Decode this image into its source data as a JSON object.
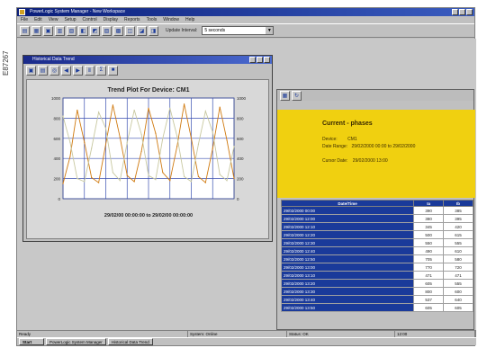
{
  "side_label": "E87267",
  "app": {
    "title": "PowerLogic System Manager - New Workspace",
    "menu": [
      "File",
      "Edit",
      "View",
      "Setup",
      "Control",
      "Display",
      "Reports",
      "Tools",
      "Window",
      "Help"
    ],
    "toolbar_label": "Update Interval:",
    "toolbar_combo": "5 seconds"
  },
  "chart_window": {
    "title": "Historical Data Trend",
    "chart_title": "Trend Plot For Device: CM1",
    "date_range": "29/02/00 00:00:00  to  29/02/00 00:00:00"
  },
  "event_window": {
    "panel_title": "Current - phases",
    "device_label": "Device:",
    "device_value": "CM1",
    "range_label": "Date Range:",
    "range_value": "29/02/2000 00:00 to 29/02/2000",
    "cursor_label": "Cursor Date:",
    "cursor_value": "29/02/2000 13:00",
    "columns": [
      "Date/Time",
      "Ia",
      "Ib"
    ],
    "rows": [
      [
        "29/02/2000 00:00",
        "390",
        "385"
      ],
      [
        "29/02/2000 12:00",
        "380",
        "395"
      ],
      [
        "29/02/2000 12:10",
        "345",
        "420"
      ],
      [
        "29/02/2000 12:20",
        "500",
        "615"
      ],
      [
        "29/02/2000 12:30",
        "550",
        "555"
      ],
      [
        "29/02/2000 12:40",
        "490",
        "610"
      ],
      [
        "29/02/2000 12:50",
        "705",
        "580"
      ],
      [
        "29/02/2000 13:00",
        "770",
        "720"
      ],
      [
        "29/02/2000 13:10",
        "471",
        "471"
      ],
      [
        "29/02/2000 13:20",
        "605",
        "555"
      ],
      [
        "29/02/2000 13:30",
        "800",
        "600"
      ],
      [
        "29/02/2000 13:40",
        "537",
        "640"
      ],
      [
        "29/02/2000 13:50",
        "605",
        "605"
      ]
    ]
  },
  "status": {
    "ready": "Ready",
    "cells": [
      "System: Online",
      "Status: OK",
      "12:00"
    ]
  },
  "taskbar": {
    "start": "Start",
    "items": [
      "PowerLogic System Manager",
      "Historical Data Trend"
    ]
  },
  "chart_data": {
    "type": "line",
    "title": "Trend Plot For Device: CM1",
    "x": [
      0,
      1,
      2,
      3,
      4,
      5,
      6,
      7,
      8,
      9,
      10,
      11,
      12,
      13,
      14,
      15,
      16,
      17,
      18,
      19,
      20,
      21,
      22,
      23,
      24
    ],
    "series": [
      {
        "values": [
          150,
          420,
          880,
          560,
          210,
          160,
          540,
          930,
          610,
          230,
          170,
          470,
          900,
          650,
          260,
          180,
          520,
          940,
          600,
          220,
          160,
          500,
          910,
          580,
          200
        ]
      },
      {
        "values": [
          820,
          560,
          200,
          170,
          500,
          860,
          700,
          260,
          180,
          560,
          880,
          640,
          230,
          190,
          600,
          900,
          620,
          220,
          170,
          540,
          870,
          660,
          240,
          180,
          520
        ]
      }
    ],
    "ylim": [
      0,
      1000
    ],
    "ylim_right": [
      0,
      1000
    ],
    "y_ticks": [
      "1000",
      "800",
      "600",
      "400",
      "200",
      "0"
    ],
    "grid": true,
    "colors": [
      "#d07a10",
      "#c8c8a0"
    ]
  }
}
